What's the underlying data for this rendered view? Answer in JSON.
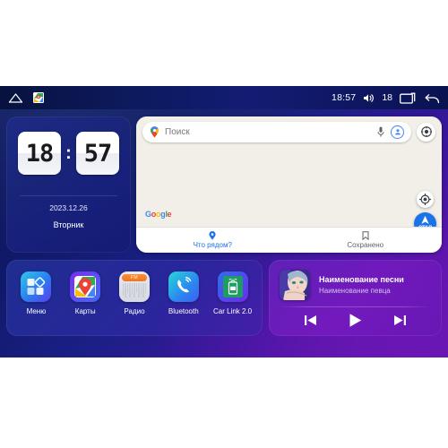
{
  "statusbar": {
    "home_icon": "home-icon",
    "maps_app_icon": "google-maps-icon",
    "time": "18:57",
    "volume_icon": "volume-icon",
    "volume_level": "18",
    "recents_icon": "recents-icon",
    "back_icon": "back-icon"
  },
  "clock_widget": {
    "hours": "18",
    "separator": ":",
    "minutes": "57",
    "date": "2023.12.26",
    "weekday": "Вторник"
  },
  "maps_widget": {
    "search_placeholder": "Поиск",
    "pin_icon": "map-pin-icon",
    "mic_icon": "microphone-icon",
    "avatar_icon": "account-avatar-icon",
    "layers_icon": "map-layers-icon",
    "location_icon": "my-location-icon",
    "start_button_label": "СТАР",
    "brand": "Google",
    "brand_letters": [
      "G",
      "o",
      "o",
      "g",
      "l",
      "e"
    ],
    "brand_colors": [
      "#4285f4",
      "#ea4335",
      "#fbbc05",
      "#4285f4",
      "#34a853",
      "#ea4335"
    ],
    "tabs": [
      {
        "label": "Что рядом?",
        "icon": "map-pin-icon",
        "active": true
      },
      {
        "label": "Сохранено",
        "icon": "bookmark-icon",
        "active": false
      }
    ]
  },
  "dock": {
    "apps": [
      {
        "label": "Меню",
        "icon": "grid-apps-icon"
      },
      {
        "label": "Карты",
        "icon": "google-maps-icon"
      },
      {
        "label": "Радио",
        "icon": "fm-radio-icon",
        "badge": "FM"
      },
      {
        "label": "Bluetooth",
        "icon": "bluetooth-phone-icon"
      },
      {
        "label": "Car Link 2.0",
        "icon": "car-link-icon"
      }
    ]
  },
  "music_widget": {
    "album_art": "album-art-portrait",
    "title": "Наименование песни",
    "artist": "Наименование певца",
    "controls": [
      {
        "name": "previous",
        "icon": "skip-previous-icon"
      },
      {
        "name": "play",
        "icon": "play-icon"
      },
      {
        "name": "next",
        "icon": "skip-next-icon"
      }
    ]
  },
  "colors": {
    "accent_blue": "#1a73e8",
    "map_bg": "#f1efe8",
    "bg_start": "#0b1352",
    "bg_end": "#6c13b0"
  }
}
